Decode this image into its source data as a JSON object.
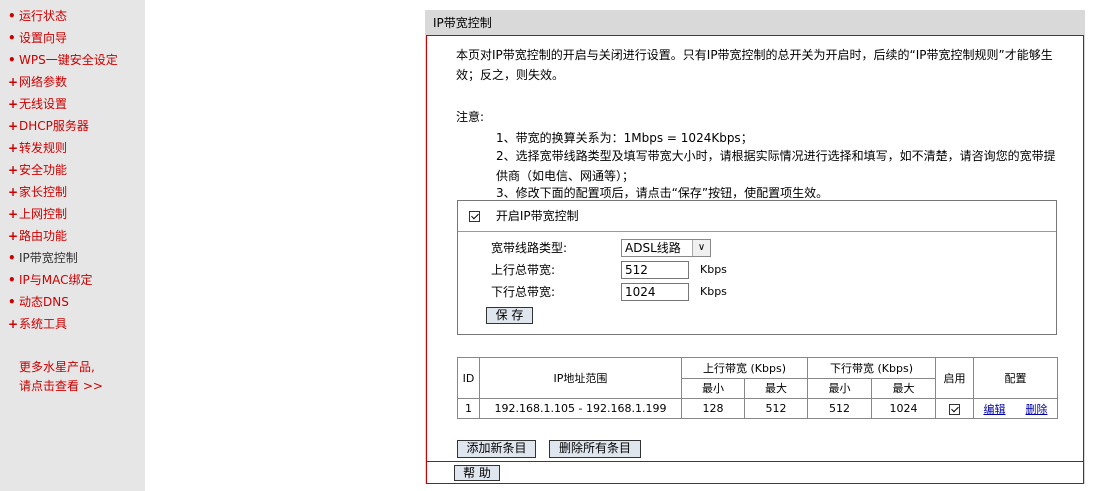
{
  "sidebar": {
    "items": [
      {
        "marker": "•",
        "label": "运行状态"
      },
      {
        "marker": "•",
        "label": "设置向导"
      },
      {
        "marker": "•",
        "label": "WPS一键安全设定"
      },
      {
        "marker": "+",
        "label": "网络参数"
      },
      {
        "marker": "+",
        "label": "无线设置"
      },
      {
        "marker": "+",
        "label": "DHCP服务器"
      },
      {
        "marker": "+",
        "label": "转发规则"
      },
      {
        "marker": "+",
        "label": "安全功能"
      },
      {
        "marker": "+",
        "label": "家长控制"
      },
      {
        "marker": "+",
        "label": "上网控制"
      },
      {
        "marker": "+",
        "label": "路由功能"
      },
      {
        "marker": "•",
        "label": "IP带宽控制"
      },
      {
        "marker": "•",
        "label": "IP与MAC绑定"
      },
      {
        "marker": "•",
        "label": "动态DNS"
      },
      {
        "marker": "+",
        "label": "系统工具"
      }
    ],
    "more_line1": "更多水星产品,",
    "more_line2": "请点击查看 >>"
  },
  "panel": {
    "title": "IP带宽控制",
    "intro": "本页对IP带宽控制的开启与关闭进行设置。只有IP带宽控制的总开关为开启时，后续的“IP带宽控制规则”才能够生效；反之，则失效。",
    "note_heading": "注意:",
    "notes": [
      "1、带宽的换算关系为：1Mbps = 1024Kbps；",
      "2、选择宽带线路类型及填写带宽大小时，请根据实际情况进行选择和填写，如不清楚，请咨询您的宽带提供商（如电信、网通等）；",
      "3、修改下面的配置项后，请点击“保存”按钮，使配置项生效。"
    ]
  },
  "settings": {
    "enable_label": "开启IP带宽控制",
    "enable_checked": true,
    "line_type_label": "宽带线路类型:",
    "line_type_value": "ADSL线路",
    "up_label": "上行总带宽:",
    "up_value": "512",
    "down_label": "下行总带宽:",
    "down_value": "1024",
    "unit": "Kbps",
    "save_label": "保 存"
  },
  "table": {
    "headers": {
      "id": "ID",
      "range": "IP地址范围",
      "up": "上行带宽 (Kbps)",
      "down": "下行带宽 (Kbps)",
      "enable": "启用",
      "config": "配置",
      "min": "最小",
      "max": "最大"
    },
    "rows": [
      {
        "id": "1",
        "range": "192.168.1.105 - 192.168.1.199",
        "up_min": "128",
        "up_max": "512",
        "down_min": "512",
        "down_max": "1024",
        "enabled": true,
        "edit": "编辑",
        "delete": "删除"
      }
    ],
    "add_label": "添加新条目",
    "delete_all_label": "删除所有条目"
  },
  "footer": {
    "help_label": "帮 助"
  }
}
